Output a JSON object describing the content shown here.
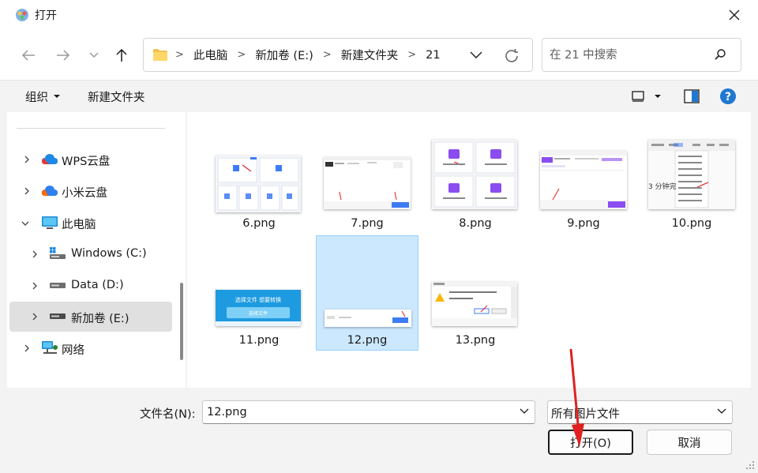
{
  "window": {
    "title": "打开"
  },
  "address": {
    "crumbs": [
      "此电脑",
      "新加卷 (E:)",
      "新建文件夹",
      "21"
    ]
  },
  "search": {
    "placeholder": "在 21 中搜索"
  },
  "toolbar": {
    "organize_label": "组织",
    "new_folder_label": "新建文件夹"
  },
  "sidebar": {
    "items": [
      {
        "label": "WPS云盘"
      },
      {
        "label": "小米云盘"
      },
      {
        "label": "此电脑"
      },
      {
        "label": "Windows (C:)"
      },
      {
        "label": "Data (D:)"
      },
      {
        "label": "新加卷 (E:)",
        "selected": true
      },
      {
        "label": "网络"
      }
    ]
  },
  "files": [
    {
      "name": "6.png"
    },
    {
      "name": "7.png"
    },
    {
      "name": "8.png"
    },
    {
      "name": "9.png"
    },
    {
      "name": "10.png"
    },
    {
      "name": "11.png"
    },
    {
      "name": "12.png",
      "selected": true
    },
    {
      "name": "13.png"
    }
  ],
  "thumbs": {
    "t11_title": "选择文件 想要转换",
    "t11_button": "选择文件",
    "t10_text": "3 分钟完"
  },
  "bottom": {
    "filename_label": "文件名(N):",
    "filename_value": "12.png",
    "filetype_value": "所有图片文件",
    "open_label": "打开(O)",
    "cancel_label": "取消"
  },
  "colors": {
    "accent": "#0067c0",
    "selection_bg": "#cce8ff",
    "selection_border": "#99d1ff",
    "annotation_red": "#e02020"
  }
}
